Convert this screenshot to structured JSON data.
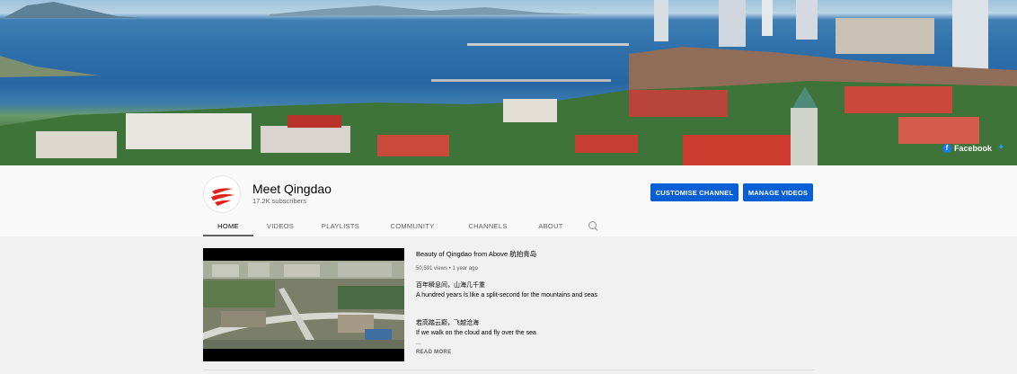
{
  "banner": {
    "social": {
      "facebook_label": "Facebook"
    }
  },
  "channel": {
    "name": "Meet Qingdao",
    "subscribers": "17.2K subscribers",
    "customise_label": "CUSTOMISE CHANNEL",
    "manage_label": "MANAGE VIDEOS"
  },
  "tabs": [
    {
      "label": "HOME",
      "active": true
    },
    {
      "label": "VIDEOS"
    },
    {
      "label": "PLAYLISTS"
    },
    {
      "label": "COMMUNITY"
    },
    {
      "label": "CHANNELS"
    },
    {
      "label": "ABOUT"
    }
  ],
  "featured": {
    "title": "Beauty of Qingdao from Above 航拍青岛",
    "meta": "50,591 views • 1 year ago",
    "desc": [
      "百年瞬息间，山海几千重",
      "A hundred years is like a split-second for the mountains and seas",
      "若高踏云巅，飞越沧海",
      "If we walk on the cloud and fly over the sea",
      "..."
    ],
    "read_more": "READ MORE"
  },
  "colors": {
    "accent": "#065fd4",
    "tab_underline": "#606060"
  }
}
